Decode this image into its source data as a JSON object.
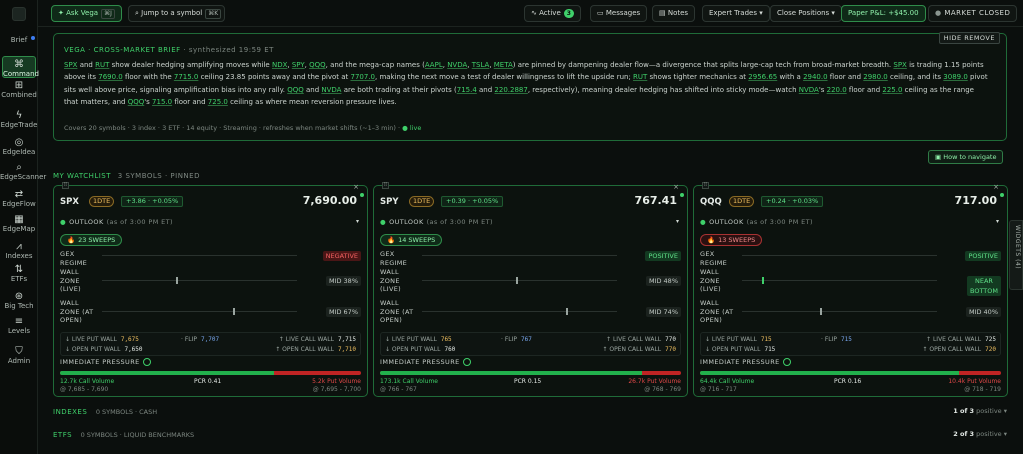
{
  "sidebar": {
    "items": [
      {
        "label": "Brief",
        "icon": "◆"
      },
      {
        "label": "Command",
        "icon": "⌘"
      },
      {
        "label": "Combined",
        "icon": "⊞"
      },
      {
        "label": "EdgeTrade",
        "icon": "ϟ"
      },
      {
        "label": "EdgeIdea",
        "icon": "◎"
      },
      {
        "label": "EdgeScanner",
        "icon": "⌕"
      },
      {
        "label": "EdgeFlow",
        "icon": "⇄"
      },
      {
        "label": "EdgeMap",
        "icon": "▦"
      },
      {
        "label": "Indexes",
        "icon": "⩘"
      },
      {
        "label": "ETFs",
        "icon": "⇅"
      },
      {
        "label": "Big Tech",
        "icon": "⊛"
      },
      {
        "label": "Levels",
        "icon": "≡"
      },
      {
        "label": "Admin",
        "icon": "⛉"
      }
    ]
  },
  "topbar": {
    "ask": "Ask Vega",
    "ask_kbd": "⌘J",
    "jump": "Jump to a symbol",
    "jump_kbd": "⌘K",
    "active": "Active",
    "active_count": "3",
    "messages": "Messages",
    "notes": "Notes",
    "expert": "Expert Trades",
    "close": "Close Positions",
    "pnl_label": "Paper P&L:",
    "pnl_value": "+$45.00",
    "market": "MARKET CLOSED"
  },
  "brief": {
    "title": "VEGA · CROSS-MARKET BRIEF",
    "synth": "· synthesized 19:59 ET",
    "hide": "HIDE REMOVE",
    "foot_left": "Covers 20 symbols · 3 index · 3 ETF · 14 equity",
    "foot_mid": "Streaming · refreshes when market shifts (~1–3 min)",
    "foot_live": "live"
  },
  "how_to": "How to navigate",
  "watchlist": {
    "label": "MY WATCHLIST",
    "meta": "3 SYMBOLS · PINNED"
  },
  "cards": [
    {
      "sym": "SPX",
      "dte": "1DTE",
      "chg": "+3.86 · +0.05%",
      "price": "7,690.00",
      "outlook": "OUTLOOK",
      "asof": "(as of 3:00 PM ET)",
      "sweeps": "23 SWEEPS",
      "sweep_color": "g",
      "gex": "NEGATIVE",
      "gex_kind": "neg",
      "wall_live": "MID 38%",
      "wall_open": "MID 67%",
      "wall_live_pos": 0.38,
      "wall_open_pos": 0.67,
      "gex_pos": 0.5,
      "lpw": "7,675",
      "flip": "7,707",
      "lcw": "7,715",
      "opw": "7,650",
      "ocw": "7,710",
      "call_vol": "12.7k Call Volume",
      "call_rng": "@ 7,685 - 7,690",
      "pcr": "PCR 0.41",
      "put_vol": "5.2k Put Volume",
      "put_rng": "@ 7,695 - 7,700",
      "call_share": 0.71
    },
    {
      "sym": "SPY",
      "dte": "1DTE",
      "chg": "+0.39 · +0.05%",
      "price": "767.41",
      "outlook": "OUTLOOK",
      "asof": "(as of 3:00 PM ET)",
      "sweeps": "14 SWEEPS",
      "sweep_color": "g",
      "gex": "POSITIVE",
      "gex_kind": "pos",
      "wall_live": "MID 48%",
      "wall_open": "MID 74%",
      "wall_live_pos": 0.48,
      "wall_open_pos": 0.74,
      "gex_pos": 0.5,
      "lpw": "765",
      "flip": "767",
      "lcw": "770",
      "opw": "760",
      "ocw": "770",
      "call_vol": "173.1k Call Volume",
      "call_rng": "@ 766 - 767",
      "pcr": "PCR 0.15",
      "put_vol": "26.7k Put Volume",
      "put_rng": "@ 768 - 769",
      "call_share": 0.87
    },
    {
      "sym": "QQQ",
      "dte": "1DTE",
      "chg": "+0.24 · +0.03%",
      "price": "717.00",
      "outlook": "OUTLOOK",
      "asof": "(as of 3:00 PM ET)",
      "sweeps": "13 SWEEPS",
      "sweep_color": "r",
      "gex": "POSITIVE",
      "gex_kind": "pos",
      "wall_live": "NEAR BOTTOM",
      "wall_open": "MID 40%",
      "wall_live_pos": 0.1,
      "wall_open_pos": 0.4,
      "gex_pos": 0.5,
      "lpw": "715",
      "flip": "715",
      "lcw": "725",
      "opw": "715",
      "ocw": "720",
      "call_vol": "64.4k Call Volume",
      "call_rng": "@ 716 - 717",
      "pcr": "PCR 0.16",
      "put_vol": "10.4k Put Volume",
      "put_rng": "@ 718 - 719",
      "call_share": 0.86
    }
  ],
  "labels": {
    "gex": "GEX\nREGIME",
    "wall_live": "WALL\nZONE\n(LIVE)",
    "wall_open": "WALL\nZONE (AT\nOPEN)",
    "lpw": "↓ LIVE PUT WALL",
    "flip": "· FLIP",
    "lcw": "↑ LIVE CALL WALL",
    "opw": "↓ OPEN PUT WALL",
    "ocw": "↑ OPEN CALL WALL",
    "imm": "IMMEDIATE PRESSURE"
  },
  "indexes": {
    "label": "INDEXES",
    "meta": "0 SYMBOLS · CASH",
    "page": "1 of 3",
    "positive": "positive ▾"
  },
  "etfs": {
    "label": "ETFS",
    "meta": "0 SYMBOLS · LIQUID BENCHMARKS",
    "page": "2 of 3",
    "positive": "positive ▾"
  },
  "widgets": "WIDGETS (4)"
}
